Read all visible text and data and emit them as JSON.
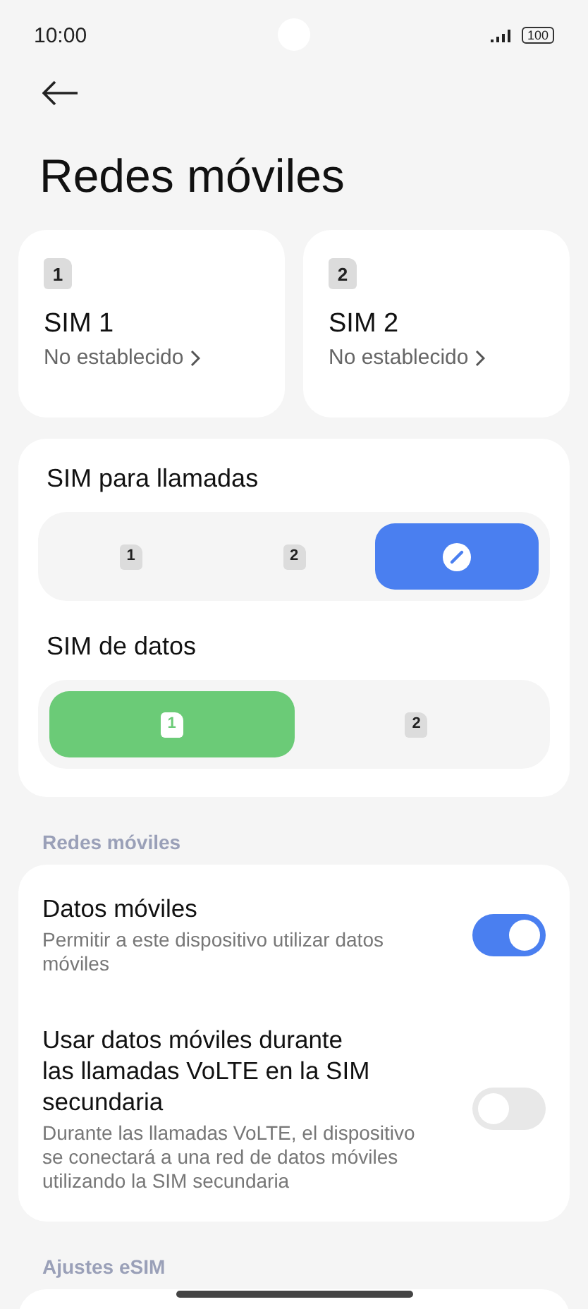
{
  "status_bar": {
    "time": "10:00",
    "battery": "100"
  },
  "title": "Redes móviles",
  "sim_cards": [
    {
      "number": "1",
      "name": "SIM 1",
      "status": "No establecido"
    },
    {
      "number": "2",
      "name": "SIM 2",
      "status": "No establecido"
    }
  ],
  "selectors": [
    {
      "kind": "calls",
      "label": "SIM para llamadas",
      "options": [
        {
          "kind": "sim",
          "number": "1",
          "selected": false
        },
        {
          "kind": "sim",
          "number": "2",
          "selected": false
        },
        {
          "kind": "ask",
          "selected": true
        }
      ]
    },
    {
      "kind": "data",
      "label": "SIM de datos",
      "options": [
        {
          "kind": "sim",
          "number": "1",
          "selected": true
        },
        {
          "kind": "sim",
          "number": "2",
          "selected": false
        }
      ]
    }
  ],
  "sections": [
    {
      "header": "Redes móviles",
      "items": [
        {
          "title": "Datos móviles",
          "description": "Permitir a este dispositivo utilizar datos móviles",
          "on": true
        },
        {
          "title": "Usar datos móviles durante las llamadas VoLTE en la SIM secundaria",
          "description": "Durante las llamadas VoLTE, el dispositivo se conectará a una red de datos móviles utilizando la SIM secundaria",
          "on": false
        }
      ]
    },
    {
      "header": "Ajustes eSIM"
    }
  ]
}
